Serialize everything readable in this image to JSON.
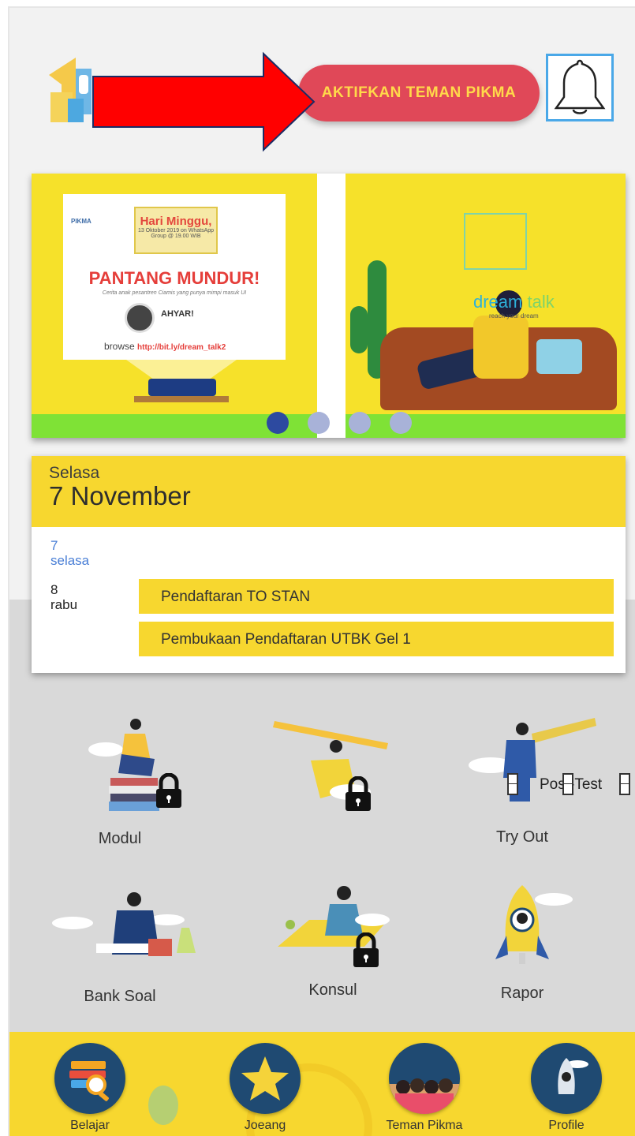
{
  "header": {
    "cta_label": "AKTIFKAN TEMAN PIKMA",
    "logo": "pikma-logo",
    "bell_icon": "bell-icon"
  },
  "banner": {
    "slide1": {
      "brand": "PIKMA",
      "date_title": "Hari Minggu,",
      "date_detail": "13 Oktober 2019 on WhatsApp Group @ 19.00 WIB",
      "headline": "PANTANG MUNDUR!",
      "subtitle": "Cerita anak pesantren Ciamis yang punya mimpi masuk UI",
      "speaker": "AHYAR!",
      "browse_label": "browse",
      "browse_url": "http://bit.ly/dream_talk2"
    },
    "slide2": {
      "dream": "dream",
      "talk": "talk",
      "tagline": "reach your dream"
    },
    "dots_count": 4,
    "active_dot": 0
  },
  "calendar": {
    "day_name": "Selasa",
    "date": "7 November",
    "today_num": "7",
    "today_name": "selasa",
    "next_num": "8",
    "next_name": "rabu",
    "events": [
      "Pendaftaran TO STAN",
      "Pembukaan Pendaftaran UTBK Gel 1"
    ]
  },
  "features": {
    "modul": "Modul",
    "tryout": "Try Out",
    "posttest": "Post-Test",
    "banksoal": "Bank Soal",
    "konsul": "Konsul",
    "rapor": "Rapor"
  },
  "nav": {
    "belajar": "Belajar",
    "joeang": "Joeang",
    "teman": "Teman Pikma",
    "profile": "Profile"
  },
  "colors": {
    "accent_yellow": "#f7d72f",
    "cta_red": "#e04858",
    "nav_circle": "#1f4a72",
    "annotation_arrow": "#ff0000"
  }
}
